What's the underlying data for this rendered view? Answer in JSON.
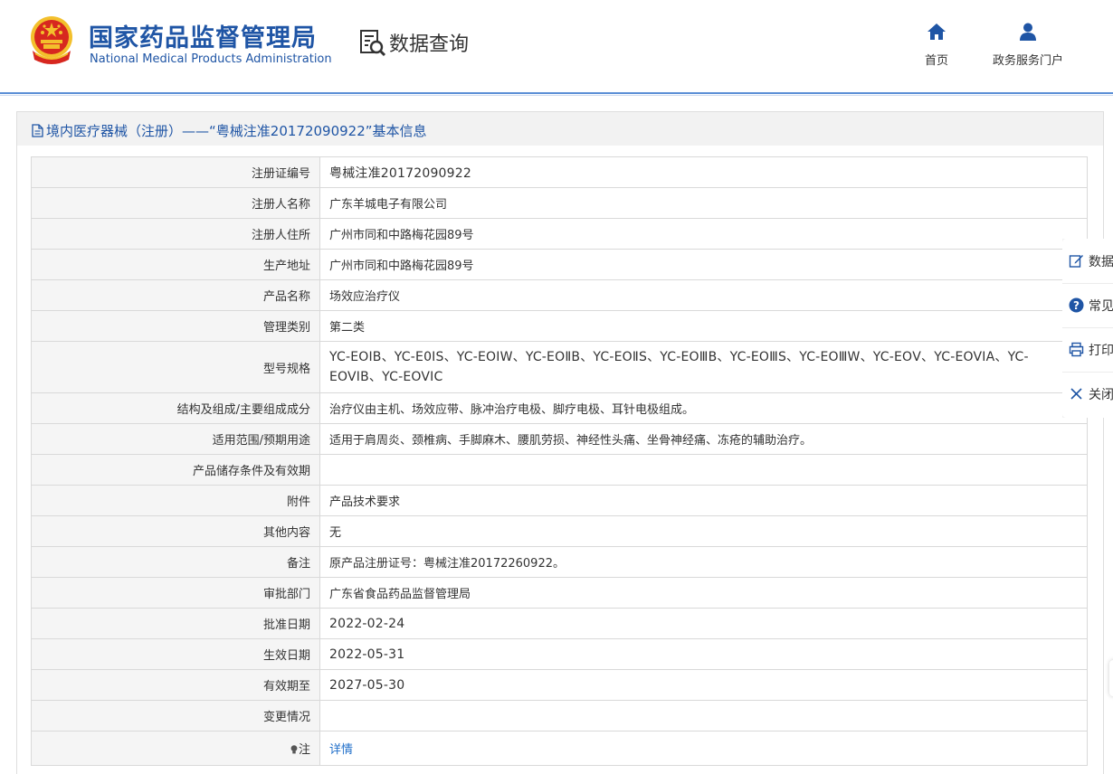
{
  "header": {
    "logo_cn": "国家药品监督管理局",
    "logo_en": "National Medical Products Administration",
    "section_title": "数据查询",
    "nav": [
      {
        "label": "首页",
        "icon": "home-icon"
      },
      {
        "label": "政务服务门户",
        "icon": "user-icon"
      }
    ]
  },
  "panel": {
    "title": "境内医疗器械（注册）——“粤械注准20172090922”基本信息"
  },
  "table": {
    "rows": [
      {
        "label": "注册证编号",
        "value": "粤械注准20172090922"
      },
      {
        "label": "注册人名称",
        "value": "广东羊城电子有限公司"
      },
      {
        "label": "注册人住所",
        "value": "广州市同和中路梅花园89号"
      },
      {
        "label": "生产地址",
        "value": "广州市同和中路梅花园89号"
      },
      {
        "label": "产品名称",
        "value": "场效应治疗仪"
      },
      {
        "label": "管理类别",
        "value": "第二类"
      },
      {
        "label": "型号规格",
        "value": "YC-EOⅠB、YC-E0ⅠS、YC-EOⅠW、YC-EOⅡB、YC-EOⅡS、YC-EOⅢB、YC-EOⅢS、YC-EOⅢW、YC-EOⅤ、YC-EOVIA、YC-EOVIB、YC-EOVIC"
      },
      {
        "label": "结构及组成/主要组成成分",
        "value": "治疗仪由主机、场效应带、脉冲治疗电极、脚疗电极、耳针电极组成。"
      },
      {
        "label": "适用范围/预期用途",
        "value": "适用于肩周炎、颈椎病、手脚麻木、腰肌劳损、神经性头痛、坐骨神经痛、冻疮的辅助治疗。"
      },
      {
        "label": "产品储存条件及有效期",
        "value": ""
      },
      {
        "label": "附件",
        "value": "产品技术要求"
      },
      {
        "label": "其他内容",
        "value": "无"
      },
      {
        "label": "备注",
        "value": "原产品注册证号：粤械注准20172260922。"
      },
      {
        "label": "审批部门",
        "value": "广东省食品药品监督管理局"
      },
      {
        "label": "批准日期",
        "value": "2022-02-24"
      },
      {
        "label": "生效日期",
        "value": "2022-05-31"
      },
      {
        "label": "有效期至",
        "value": "2027-05-30"
      },
      {
        "label": "变更情况",
        "value": ""
      },
      {
        "label": "注",
        "value": "详情"
      }
    ]
  },
  "side_toolbar": [
    {
      "label": "数据纠错",
      "icon": "edit-icon"
    },
    {
      "label": "常见问题",
      "icon": "question-icon"
    },
    {
      "label": "打印",
      "icon": "print-icon"
    },
    {
      "label": "关闭",
      "icon": "close-icon"
    }
  ],
  "colors": {
    "brand_blue": "#1f55a5",
    "link_blue": "#1f6ec9",
    "emblem_red": "#d7271f",
    "emblem_gold": "#f3c02c"
  }
}
